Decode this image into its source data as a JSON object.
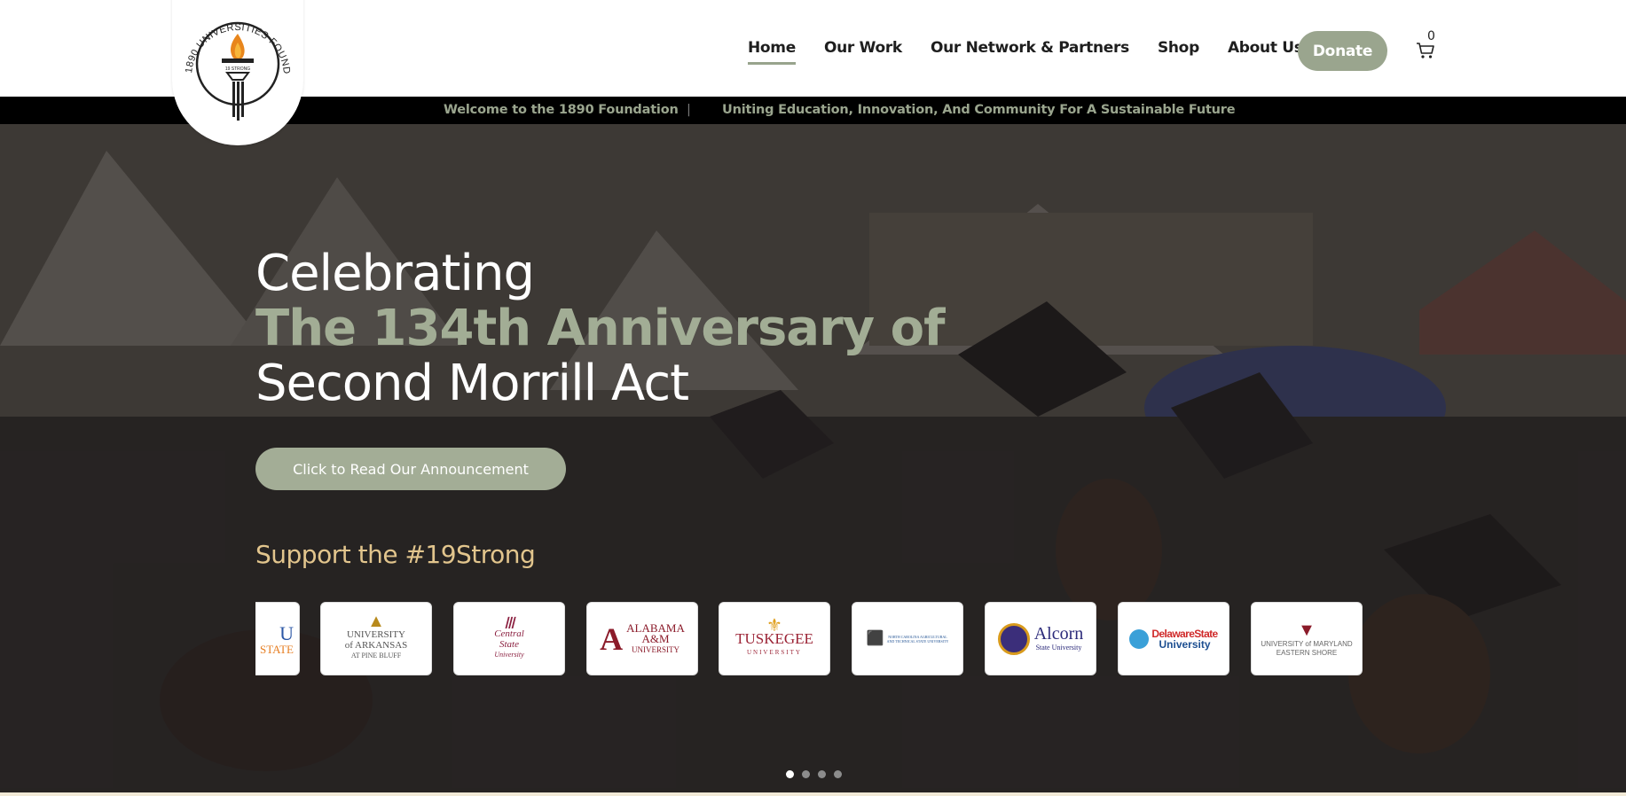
{
  "logo": {
    "ring_text": "1890 UNIVERSITIES FOUNDATION",
    "badge_text": "19 STRONG"
  },
  "nav": {
    "items": [
      {
        "label": "Home",
        "active": true
      },
      {
        "label": "Our Work",
        "active": false
      },
      {
        "label": "Our Network & Partners",
        "active": false
      },
      {
        "label": "Shop",
        "active": false
      },
      {
        "label": "About Us",
        "active": false
      }
    ],
    "donate_label": "Donate",
    "cart_count": "0",
    "cart_icon": "cart-icon"
  },
  "ticker": {
    "left": "Welcome to the 1890 Foundation",
    "separator": "|",
    "right": "Uniting Education, Innovation, And Community For A Sustainable Future"
  },
  "hero": {
    "line1": "Celebrating",
    "line2": "The 134th Anniversary of",
    "line3": "Second Morrill Act",
    "cta_label": "Click to Read Our Announcement",
    "support_text": "Support the #19Strong"
  },
  "universities": [
    {
      "name": "STATE",
      "lines": [
        "U",
        "STATE"
      ]
    },
    {
      "name": "University of Arkansas at Pine Bluff",
      "lines": [
        "UNIVERSITY",
        "of ARKANSAS",
        "AT PINE BLUFF"
      ]
    },
    {
      "name": "Central State University",
      "lines": [
        "Central",
        "State",
        "University"
      ]
    },
    {
      "name": "Alabama A&M University",
      "lines": [
        "ALABAMA",
        "A&M",
        "UNIVERSITY"
      ]
    },
    {
      "name": "Tuskegee University",
      "lines": [
        "TUSKEGEE",
        "UNIVERSITY"
      ]
    },
    {
      "name": "North Carolina Agricultural and Technical State University",
      "lines": [
        "NORTH CAROLINA AGRICULTURAL",
        "AND TECHNICAL STATE UNIVERSITY"
      ]
    },
    {
      "name": "Alcorn State University",
      "lines": [
        "Alcorn",
        "State University"
      ]
    },
    {
      "name": "Delaware State University",
      "lines": [
        "DelawareState",
        "University"
      ]
    },
    {
      "name": "University of Maryland Eastern Shore",
      "lines": [
        "UNIVERSITY of MARYLAND",
        "EASTERN SHORE"
      ]
    }
  ],
  "carousel": {
    "dots": 4,
    "active_dot": 0
  },
  "colors": {
    "sage": "#9aa58e",
    "gold": "#e2c58d",
    "black": "#000000"
  }
}
